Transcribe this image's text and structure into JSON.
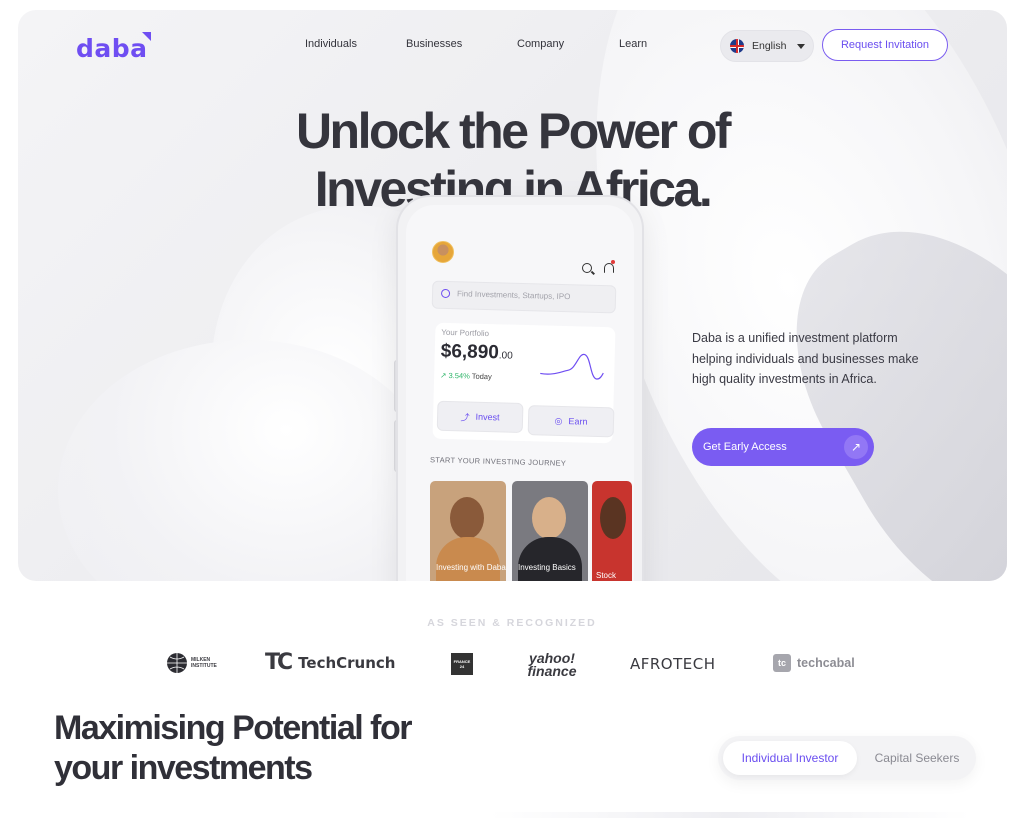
{
  "brand": {
    "logo": "daba",
    "accent": "#6f4ef2"
  },
  "nav": {
    "items": [
      "Individuals",
      "Businesses",
      "Company",
      "Learn"
    ],
    "language": "English",
    "request_label": "Request Invitation"
  },
  "hero": {
    "title_line1": "Unlock the Power of",
    "title_line2": "Investing in Africa.",
    "description": "Daba is a unified investment platform helping individuals and businesses make high quality investments in Africa.",
    "cta_label": "Get Early Access",
    "cta_icon": "arrow-up-right-icon"
  },
  "phone": {
    "search_placeholder": "Find Investments, Startups, IPO",
    "portfolio_label": "Your Portfolio",
    "portfolio_value": "$6,890",
    "portfolio_cents": ".00",
    "portfolio_change": "3.54%",
    "portfolio_change_suffix": "Today",
    "invest_label": "Invest",
    "earn_label": "Earn",
    "journey_label": "START YOUR INVESTING JOURNEY",
    "cards": [
      "Investing with Daba",
      "Investing Basics",
      "Stock"
    ]
  },
  "press": {
    "heading": "AS SEEN & RECOGNIZED",
    "logos": [
      "MILKEN INSTITUTE",
      "TechCrunch",
      "FRANCE 24",
      "yahoo! finance",
      "AFROTECH",
      "techcabal"
    ]
  },
  "section": {
    "title_line1": "Maximising Potential for",
    "title_line2": "your investments",
    "toggle_active": "Individual Investor",
    "toggle_inactive": "Capital Seekers"
  }
}
